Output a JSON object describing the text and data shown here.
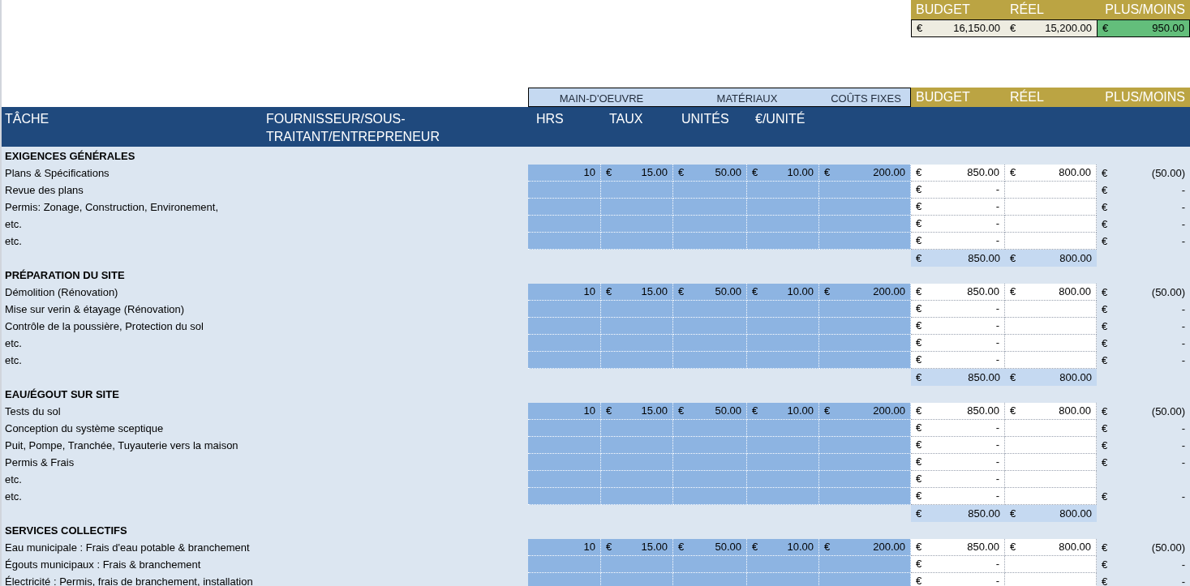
{
  "summary": {
    "columns": [
      "BUDGET",
      "RÉEL",
      "PLUS/MOINS"
    ],
    "values": [
      [
        "€",
        "16,150.00"
      ],
      [
        "€",
        "15,200.00"
      ],
      [
        "€",
        "950.00"
      ]
    ]
  },
  "group_headers": [
    "MAIN-D'OEUVRE",
    "MATÉRIAUX",
    "COÛTS FIXES"
  ],
  "side_headers": [
    "BUDGET",
    "RÉEL",
    "PLUS/MOINS"
  ],
  "columns": [
    "TÂCHE",
    "FOURNISSEUR/SOUS-TRAITANT/ENTREPRENEUR",
    "HRS",
    "TAUX",
    "UNITÉS",
    "€/UNITÉ"
  ],
  "sections": [
    {
      "title": "EXIGENCES GÉNÉRALES",
      "items": [
        {
          "task": "Plans & Spécifications",
          "hrs": "10",
          "taux": [
            "€",
            "15.00"
          ],
          "unites": [
            "€",
            "50.00"
          ],
          "prix_unite": [
            "€",
            "10.00"
          ],
          "couts_fixes": [
            "€",
            "200.00"
          ],
          "budget": [
            "€",
            "850.00"
          ],
          "reel": [
            "€",
            "800.00"
          ],
          "plus_moins": [
            "€",
            "(50.00)"
          ]
        },
        {
          "task": "Revue des plans",
          "budget": [
            "€",
            "-"
          ],
          "plus_moins": [
            "€",
            "-"
          ]
        },
        {
          "task": "Permis: Zonage, Construction, Environement,",
          "budget": [
            "€",
            "-"
          ],
          "plus_moins": [
            "€",
            "-"
          ]
        },
        {
          "task": "etc.",
          "budget": [
            "€",
            "-"
          ],
          "plus_moins": [
            "€",
            "-"
          ]
        },
        {
          "task": "etc.",
          "budget": [
            "€",
            "-"
          ],
          "plus_moins": [
            "€",
            "-"
          ]
        }
      ],
      "totals": {
        "budget": [
          "€",
          "850.00"
        ],
        "reel": [
          "€",
          "800.00"
        ]
      }
    },
    {
      "title": "PRÉPARATION DU SITE",
      "items": [
        {
          "task": "Démolition (Rénovation)",
          "hrs": "10",
          "taux": [
            "€",
            "15.00"
          ],
          "unites": [
            "€",
            "50.00"
          ],
          "prix_unite": [
            "€",
            "10.00"
          ],
          "couts_fixes": [
            "€",
            "200.00"
          ],
          "budget": [
            "€",
            "850.00"
          ],
          "reel": [
            "€",
            "800.00"
          ],
          "plus_moins": [
            "€",
            "(50.00)"
          ]
        },
        {
          "task": "Mise sur verin & étayage (Rénovation)",
          "budget": [
            "€",
            "-"
          ],
          "plus_moins": [
            "€",
            "-"
          ]
        },
        {
          "task": "Contrôle de la poussière, Protection du sol",
          "budget": [
            "€",
            "-"
          ],
          "plus_moins": [
            "€",
            "-"
          ]
        },
        {
          "task": "etc.",
          "budget": [
            "€",
            "-"
          ],
          "plus_moins": [
            "€",
            "-"
          ]
        },
        {
          "task": "etc.",
          "budget": [
            "€",
            "-"
          ],
          "plus_moins": [
            "€",
            "-"
          ]
        }
      ],
      "totals": {
        "budget": [
          "€",
          "850.00"
        ],
        "reel": [
          "€",
          "800.00"
        ]
      }
    },
    {
      "title": "EAU/ÉGOUT SUR SITE",
      "items": [
        {
          "task": "Tests du sol",
          "hrs": "10",
          "taux": [
            "€",
            "15.00"
          ],
          "unites": [
            "€",
            "50.00"
          ],
          "prix_unite": [
            "€",
            "10.00"
          ],
          "couts_fixes": [
            "€",
            "200.00"
          ],
          "budget": [
            "€",
            "850.00"
          ],
          "reel": [
            "€",
            "800.00"
          ],
          "plus_moins": [
            "€",
            "(50.00)"
          ]
        },
        {
          "task": "Conception du système sceptique",
          "budget": [
            "€",
            "-"
          ],
          "plus_moins": [
            "€",
            "-"
          ]
        },
        {
          "task": "Puit, Pompe, Tranchée, Tuyauterie vers la maison",
          "budget": [
            "€",
            "-"
          ],
          "plus_moins": [
            "€",
            "-"
          ]
        },
        {
          "task": "Permis & Frais",
          "budget": [
            "€",
            "-"
          ],
          "plus_moins": [
            "€",
            "-"
          ]
        },
        {
          "task": "etc.",
          "budget": [
            "€",
            "-"
          ]
        },
        {
          "task": "etc.",
          "budget": [
            "€",
            "-"
          ],
          "plus_moins": [
            "€",
            "-"
          ]
        }
      ],
      "totals": {
        "budget": [
          "€",
          "850.00"
        ],
        "reel": [
          "€",
          "800.00"
        ]
      }
    },
    {
      "title": "SERVICES COLLECTIFS",
      "items": [
        {
          "task": "Eau municipale : Frais d'eau potable & branchement",
          "hrs": "10",
          "taux": [
            "€",
            "15.00"
          ],
          "unites": [
            "€",
            "50.00"
          ],
          "prix_unite": [
            "€",
            "10.00"
          ],
          "couts_fixes": [
            "€",
            "200.00"
          ],
          "budget": [
            "€",
            "850.00"
          ],
          "reel": [
            "€",
            "800.00"
          ],
          "plus_moins": [
            "€",
            "(50.00)"
          ]
        },
        {
          "task": "Égouts municipaux : Frais & branchement",
          "budget": [
            "€",
            "-"
          ],
          "plus_moins": [
            "€",
            "-"
          ]
        },
        {
          "task": "Électricité : Permis, frais de branchement, installation",
          "budget": [
            "€",
            "-"
          ],
          "plus_moins": [
            "€",
            "-"
          ]
        }
      ]
    }
  ]
}
